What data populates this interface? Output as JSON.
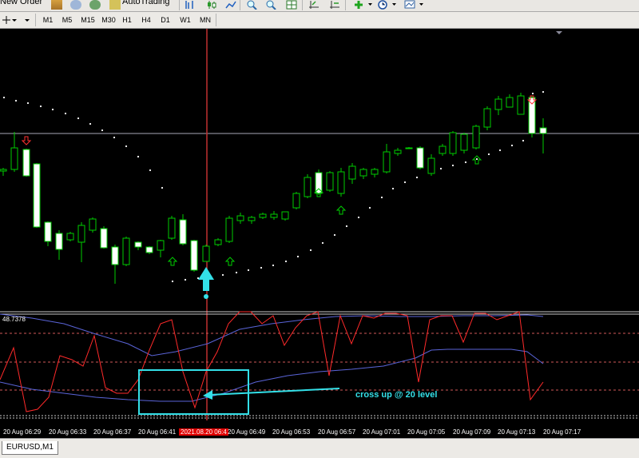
{
  "toolbar": {
    "new_order": "New Order",
    "auto_trading": "AutoTrading"
  },
  "timeframes": [
    "M1",
    "M5",
    "M15",
    "M30",
    "H1",
    "H4",
    "D1",
    "W1",
    "MN"
  ],
  "time_axis": {
    "labels": [
      "20 Aug 06:29",
      "20 Aug 06:33",
      "20 Aug 06:37",
      "20 Aug 06:41",
      "20 Aug 06:49",
      "20 Aug 06:53",
      "20 Aug 06:57",
      "20 Aug 07:01",
      "20 Aug 07:05",
      "20 Aug 07:09",
      "20 Aug 07:13",
      "20 Aug 07:17"
    ],
    "crosshair_label": "2021.08.20 06:4"
  },
  "indicator": {
    "value_label": "48.7378"
  },
  "annotation": "cross up @ 20 level",
  "tab": {
    "label": "EURUSD,M1"
  },
  "colors": {
    "bull_body": "#000000",
    "bear_body": "#ffffff",
    "candle_outline": "#00cc00",
    "stoch_line": "#ff2a2a",
    "band_line": "#5a64d8",
    "level_line": "#d05858",
    "crosshair": "#c03030",
    "highlight_box": "#33e0e8"
  },
  "icons": {
    "buy_signal": "up-arrow-icon",
    "sell_signal": "down-arrow-icon",
    "crossover_marker": "big-up-arrow-icon"
  }
}
